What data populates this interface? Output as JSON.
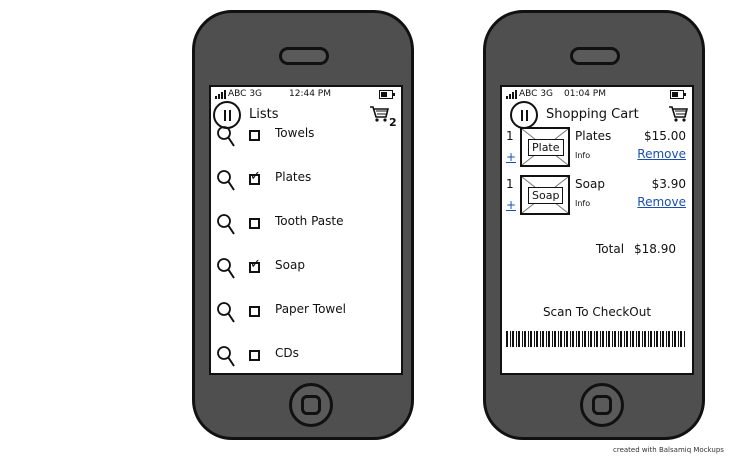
{
  "status_left": {
    "carrier": "ABC 3G",
    "time": "12:44 PM"
  },
  "status_right": {
    "carrier": "ABC 3G",
    "time": "01:04 PM"
  },
  "lists_screen": {
    "title": "Lists",
    "cart_badge": "2",
    "items": [
      {
        "label": "Towels",
        "checked": false
      },
      {
        "label": "Plates",
        "checked": true
      },
      {
        "label": "Tooth Paste",
        "checked": false
      },
      {
        "label": "Soap",
        "checked": true
      },
      {
        "label": "Paper Towel",
        "checked": false
      },
      {
        "label": "CDs",
        "checked": false
      }
    ]
  },
  "cart_screen": {
    "title": "Shopping Cart",
    "items": [
      {
        "qty": "1",
        "plus": "+",
        "thumb": "Plate",
        "name": "Plates",
        "info": "Info",
        "price": "$15.00",
        "remove": "Remove"
      },
      {
        "qty": "1",
        "plus": "+",
        "thumb": "Soap",
        "name": "Soap",
        "info": "Info",
        "price": "$3.90",
        "remove": "Remove"
      }
    ],
    "total_label": "Total",
    "total_value": "$18.90",
    "scan_label": "Scan To CheckOut"
  },
  "footer": {
    "credit": "created with Balsamiq Mockups"
  },
  "colors": {
    "phone_body": "#4f4f4f",
    "link": "#1a4fb0"
  }
}
